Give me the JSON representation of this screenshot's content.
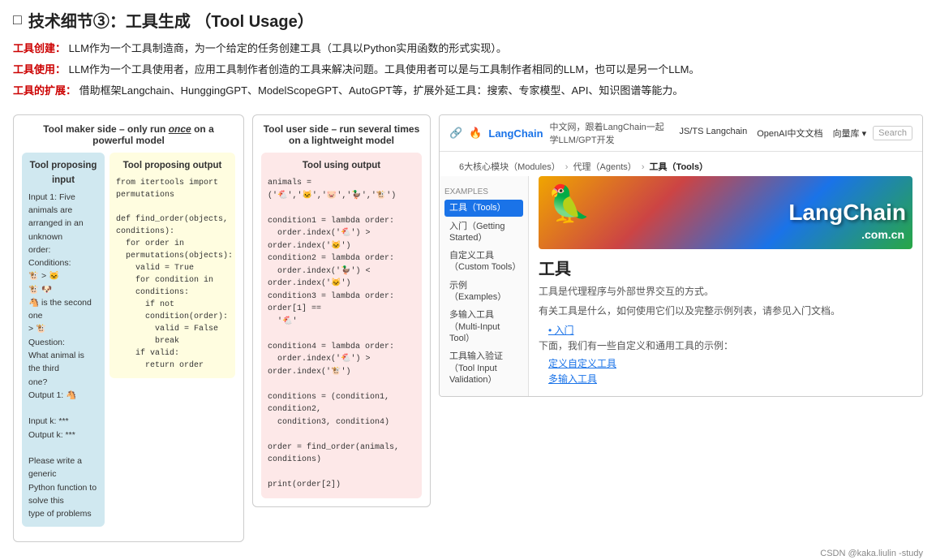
{
  "header": {
    "icon": "□",
    "title_cn": "技术细节③：工具生成",
    "title_en": "（Tool Usage）"
  },
  "descriptions": [
    {
      "label": "工具创建：",
      "text": "LLM作为一个工具制造商，为一个给定的任务创建工具（工具以Python实用函数的形式实现）。"
    },
    {
      "label": "工具使用：",
      "text": "LLM作为一个工具使用者，应用工具制作者创造的工具来解决问题。工具使用者可以是与工具制作者相同的LLM，也可以是另一个LLM。"
    },
    {
      "label": "工具的扩展：",
      "text": "借助框架Langchain、HunggingGPT、ModelScopeGPT、AutoGPT等，扩展外延工具：搜索、专家模型、API、知识图谱等能力。"
    }
  ],
  "left_panel": {
    "header": "Tool maker side – only run once on a powerful model",
    "header_italic": "once",
    "input_box": {
      "title": "Tool proposing input",
      "lines": [
        "Input 1: Five animals are",
        "arranged in an unknown",
        "order:",
        "Conditions:",
        "🐮 > 🐱",
        "🐮 🐶",
        "🐴 is the second one",
        "> 🐮",
        "Question:",
        "What animal is the third",
        "one?",
        "Output 1: 🐴",
        "",
        "Input k: ***",
        "Output k: ***",
        "",
        "Please write a generic",
        "Python function to solve this",
        "type of problems"
      ]
    },
    "output_box": {
      "title": "Tool proposing output",
      "lines": [
        "from itertools import",
        "permutations",
        "",
        "def find_order(objects,",
        "conditions):",
        "  for order in",
        "  permutations(objects):",
        "    valid = True",
        "    for condition in",
        "    conditions:",
        "      if not",
        "      condition(order):",
        "        valid = False",
        "        break",
        "    if valid:",
        "      return order"
      ]
    }
  },
  "middle_panel": {
    "header": "Tool user side – run several times on a lightweight model",
    "output_box": {
      "title": "Tool using output",
      "lines": [
        "animals = ('🐔','🐱','🐷','🦆','🐮')",
        "",
        "condition1 = lambda order:",
        "  order.index('🐔') > order.index('🐱')",
        "condition2 = lambda order:",
        "  order.index('🦆') < order.index('🐱')",
        "condition3 = lambda order: order[1] ==",
        "  '🐔'",
        "",
        "condition4 = lambda order:",
        "  order.index('🐔') > order.index('🐮')",
        "",
        "conditions = (condition1, condition2,",
        "  condition3, condition4)",
        "",
        "order = find_order(animals, conditions)",
        "",
        "print(order[2])"
      ]
    }
  },
  "langchain_panel": {
    "navbar": {
      "logo": "LangChain",
      "logo_emoji": "🔗",
      "fire_emoji": "🔥",
      "desc": "中文网，跟着LangChain一起学LLM/GPT开发",
      "links": [
        "JS/TS Langchain",
        "OpenAI中文文档",
        "向量库 ▾"
      ],
      "search": "Search"
    },
    "breadcrumb": {
      "items": [
        "6大核心模块（Modules）",
        "代理（Agents）",
        "工具（Tools）"
      ]
    },
    "sidebar": {
      "section": "Examples",
      "items": [
        {
          "label": "工具（Tools）",
          "active": true
        },
        {
          "label": "入门（Getting Started）",
          "active": false
        },
        {
          "label": "自定义工具（Custom Tools）",
          "active": false
        },
        {
          "label": "示例（Examples）",
          "active": false
        },
        {
          "label": "多输入工具（Multi-Input Tool）",
          "active": false
        },
        {
          "label": "工具输入验证（Tool Input Validation）",
          "active": false
        }
      ]
    },
    "main": {
      "hero_parrot": "🦜",
      "hero_logo": "LangChain",
      "hero_sub": ".com.cn",
      "title": "工具",
      "desc1": "工具是代理程序与外部世界交互的方式。",
      "desc2": "有关工具是什么，如何使用它们以及完整示例列表，请参见入门文档。",
      "links": [
        "• 入门"
      ],
      "list_intro": "下面，我们有一些自定义和通用工具的示例：",
      "list_links": [
        "定义自定义工具",
        "多输入工具"
      ]
    }
  },
  "watermark": "CSDN @kaka.liulin -study"
}
